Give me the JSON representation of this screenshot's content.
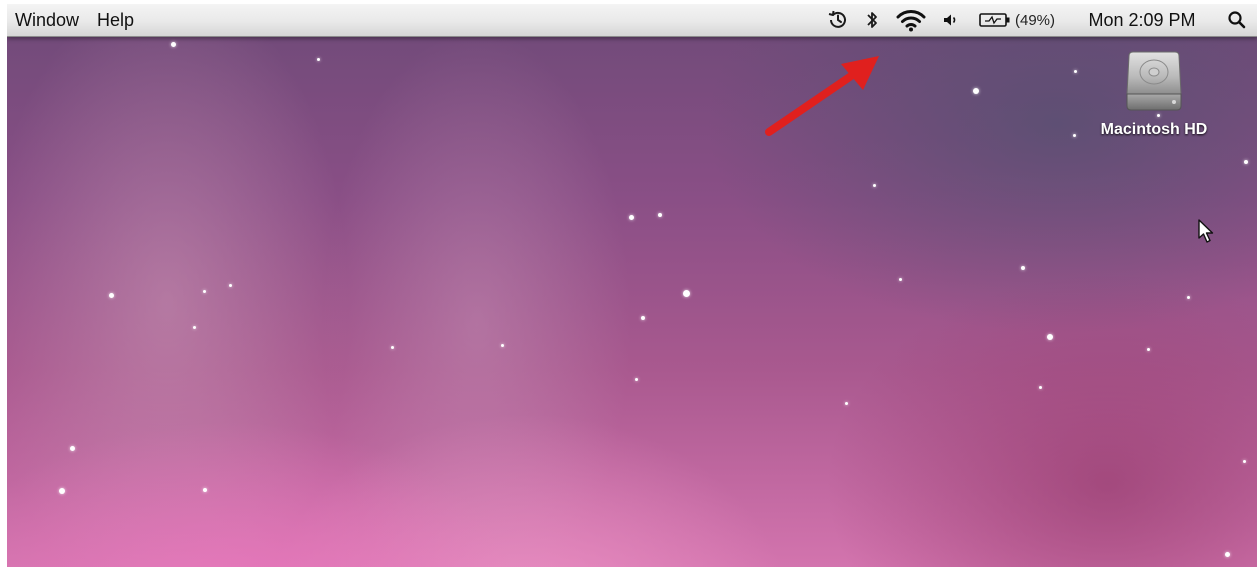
{
  "menubar": {
    "menus": [
      {
        "label": "Window"
      },
      {
        "label": "Help"
      }
    ],
    "status": {
      "time_machine_icon": "time-machine-icon",
      "bluetooth_icon": "bluetooth-icon",
      "wifi_icon": "wifi-icon",
      "volume_icon": "volume-icon",
      "battery_icon": "battery-icon",
      "battery_percent": "(49%)",
      "clock": "Mon 2:09 PM",
      "spotlight_icon": "spotlight-search-icon"
    }
  },
  "desktop": {
    "drive_label": "Macintosh HD",
    "drive_icon": "hard-drive-icon",
    "annotation": {
      "type": "arrow",
      "color": "#e0201e",
      "points_to": "wifi-icon"
    },
    "cursor_icon": "mouse-pointer-icon"
  },
  "colors": {
    "menubar": "#e9e9e9",
    "wallpaper_top": "#6e4a78",
    "wallpaper_bottom": "#d374ae",
    "arrow": "#e0201e"
  }
}
